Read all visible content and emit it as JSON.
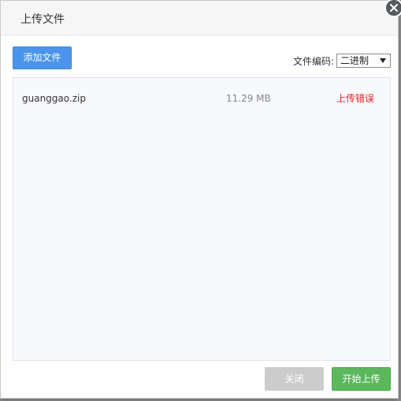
{
  "dialog": {
    "title": "上传文件",
    "close_icon": "close-icon"
  },
  "toolbar": {
    "add_file_label": "添加文件",
    "encoding_label": "文件编码:",
    "encoding_selected": "二进制"
  },
  "files": [
    {
      "name": "guanggao.zip",
      "size": "11.29 MB",
      "status": "上传错误"
    }
  ],
  "footer": {
    "close_label": "关闭",
    "start_label": "开始上传"
  },
  "colors": {
    "primary_button": "#4a95eb",
    "start_button": "#5cb85c",
    "disabled_button": "#cccccc",
    "error_text": "#e02020",
    "list_background": "#f7f9fd"
  }
}
